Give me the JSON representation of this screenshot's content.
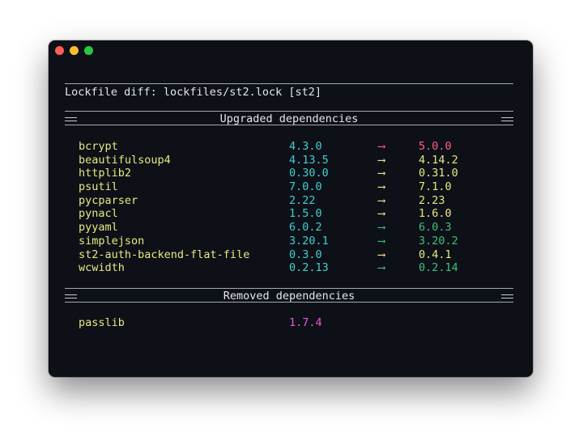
{
  "window": {
    "lights": [
      "#ff5f57",
      "#febc2e",
      "#28c840"
    ]
  },
  "title": "Lockfile diff: lockfiles/st2.lock [st2]",
  "upgraded": {
    "heading": "Upgraded dependencies",
    "arrow": "⟶",
    "rows": [
      {
        "name": "bcrypt",
        "old": "4.3.0",
        "new": "5.0.0",
        "arrow_color": "#ff5f87",
        "old_color": "#3fd0d0",
        "new_color": "#ff5f87"
      },
      {
        "name": "beautifulsoup4",
        "old": "4.13.5",
        "new": "4.14.2",
        "arrow_color": "#e6ea7e",
        "old_color": "#3fd0d0",
        "new_color": "#e6ea7e"
      },
      {
        "name": "httplib2",
        "old": "0.30.0",
        "new": "0.31.0",
        "arrow_color": "#e6ea7e",
        "old_color": "#3fd0d0",
        "new_color": "#e6ea7e"
      },
      {
        "name": "psutil",
        "old": "7.0.0",
        "new": "7.1.0",
        "arrow_color": "#e6ea7e",
        "old_color": "#3fd0d0",
        "new_color": "#e6ea7e"
      },
      {
        "name": "pycparser",
        "old": "2.22",
        "new": "2.23",
        "arrow_color": "#e6ea7e",
        "old_color": "#3fd0d0",
        "new_color": "#e6ea7e"
      },
      {
        "name": "pynacl",
        "old": "1.5.0",
        "new": "1.6.0",
        "arrow_color": "#e6ea7e",
        "old_color": "#3fd0d0",
        "new_color": "#e6ea7e"
      },
      {
        "name": "pyyaml",
        "old": "6.0.2",
        "new": "6.0.3",
        "arrow_color": "#3fc07a",
        "old_color": "#3fd0d0",
        "new_color": "#3fc07a"
      },
      {
        "name": "simplejson",
        "old": "3.20.1",
        "new": "3.20.2",
        "arrow_color": "#3fc07a",
        "old_color": "#3fd0d0",
        "new_color": "#3fc07a"
      },
      {
        "name": "st2-auth-backend-flat-file",
        "old": "0.3.0",
        "new": "0.4.1",
        "arrow_color": "#e6ea7e",
        "old_color": "#3fd0d0",
        "new_color": "#e6ea7e"
      },
      {
        "name": "wcwidth",
        "old": "0.2.13",
        "new": "0.2.14",
        "arrow_color": "#3fc07a",
        "old_color": "#3fd0d0",
        "new_color": "#3fc07a"
      }
    ]
  },
  "removed": {
    "heading": "Removed dependencies",
    "rows": [
      {
        "name": "passlib",
        "old": "1.7.4",
        "old_color": "#e05ad6"
      }
    ]
  }
}
